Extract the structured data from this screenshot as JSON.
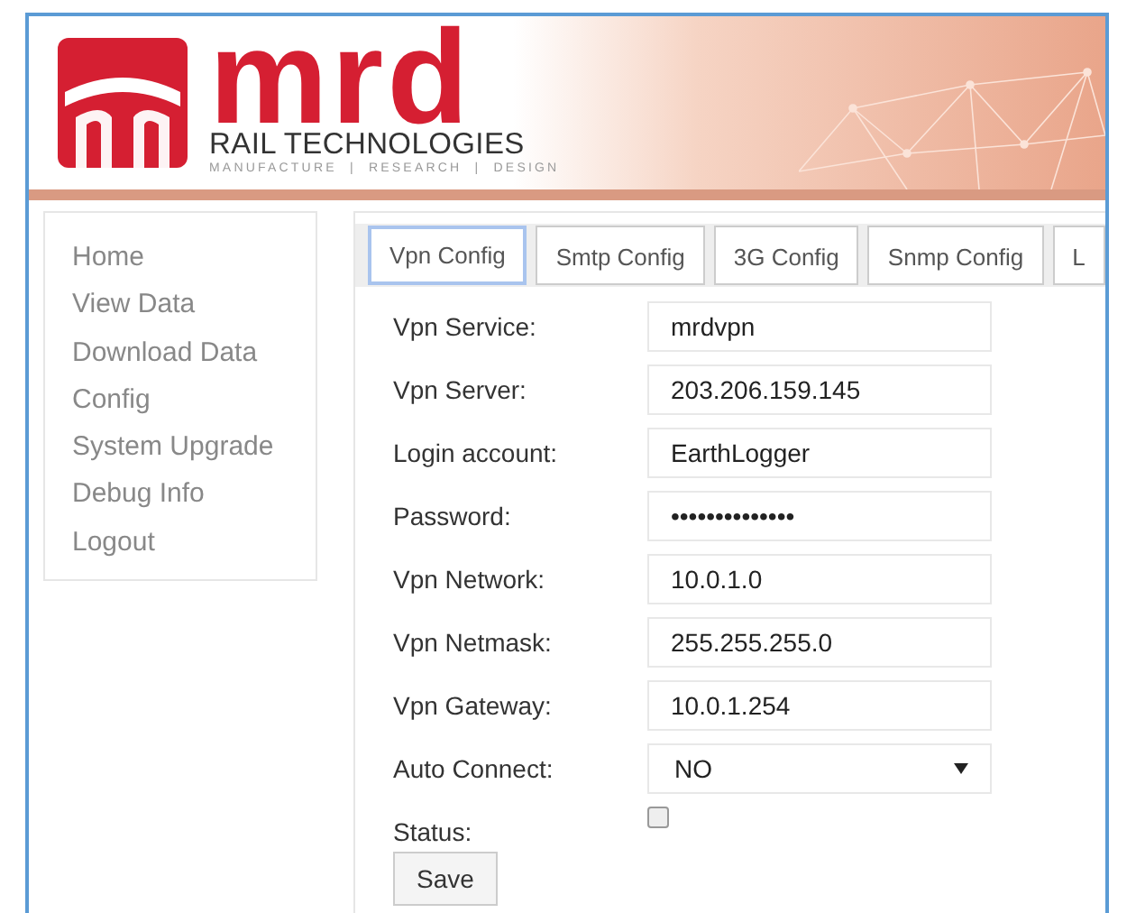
{
  "header": {
    "logo_text": "mrd",
    "company_name": "RAIL TECHNOLOGIES",
    "tagline": "MANUFACTURE  |  RESEARCH  |  DESIGN"
  },
  "sidebar": {
    "items": [
      "Home",
      "View Data",
      "Download Data",
      "Config",
      "System Upgrade",
      "Debug Info",
      "Logout"
    ]
  },
  "tabs": [
    {
      "label": "Vpn Config",
      "selected": true
    },
    {
      "label": "Smtp Config",
      "selected": false
    },
    {
      "label": "3G Config",
      "selected": false
    },
    {
      "label": "Snmp Config",
      "selected": false
    },
    {
      "label": "L",
      "selected": false
    }
  ],
  "form": {
    "fields": [
      {
        "kind": "text",
        "label": "Vpn Service:",
        "value": "mrdvpn"
      },
      {
        "kind": "text",
        "label": "Vpn Server:",
        "value": "203.206.159.145"
      },
      {
        "kind": "text",
        "label": "Login account:",
        "value": "EarthLogger"
      },
      {
        "kind": "password",
        "label": "Password:",
        "value": "••••••••••••••"
      },
      {
        "kind": "text",
        "label": "Vpn Network:",
        "value": "10.0.1.0"
      },
      {
        "kind": "text",
        "label": "Vpn Netmask:",
        "value": "255.255.255.0"
      },
      {
        "kind": "text",
        "label": "Vpn Gateway:",
        "value": "10.0.1.254"
      },
      {
        "kind": "select",
        "label": "Auto Connect:",
        "value": "NO"
      },
      {
        "kind": "checkbox",
        "label": "Status:",
        "checked": false
      }
    ],
    "save_button": "Save"
  }
}
